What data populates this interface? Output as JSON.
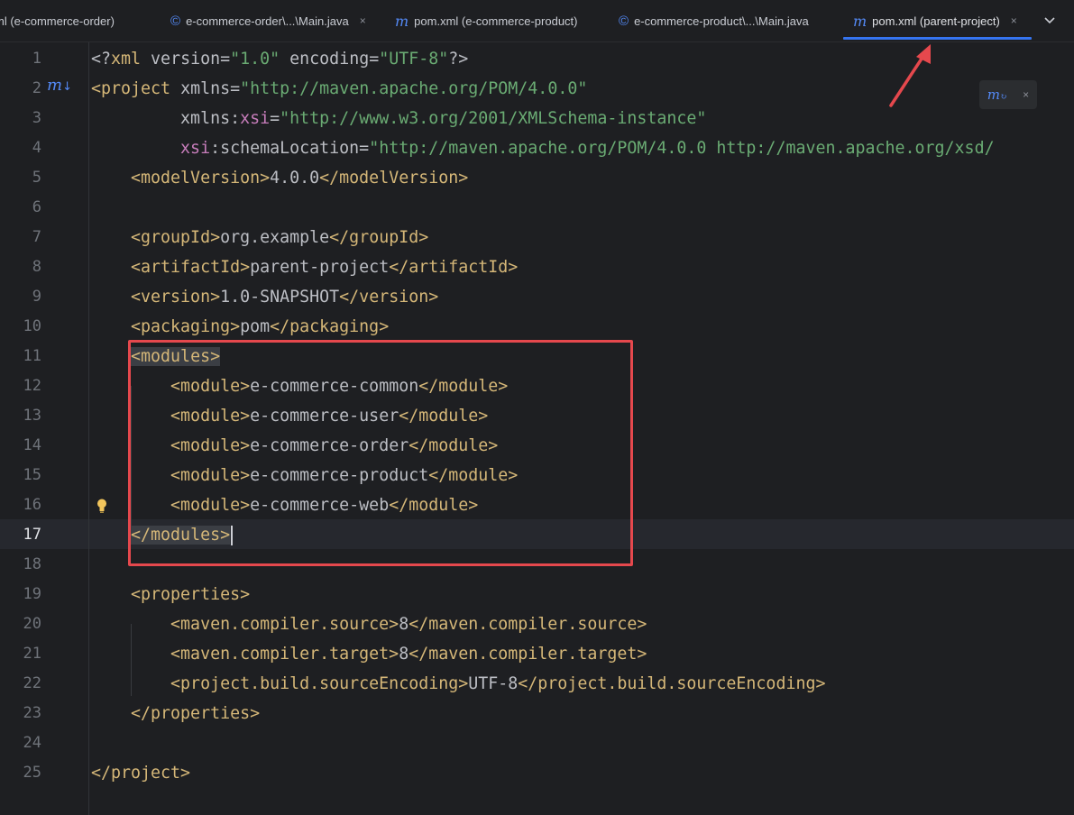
{
  "tabs": [
    {
      "label": "ml (e-commerce-order)",
      "icon": "none",
      "closable": false,
      "active": false
    },
    {
      "label": "e-commerce-order\\...\\Main.java",
      "icon": "java-class-icon",
      "closable": true,
      "active": false
    },
    {
      "label": "pom.xml (e-commerce-product)",
      "icon": "maven-icon",
      "closable": false,
      "active": false
    },
    {
      "label": "e-commerce-product\\...\\Main.java",
      "icon": "java-class-icon",
      "closable": false,
      "active": false
    },
    {
      "label": "pom.xml (parent-project)",
      "icon": "maven-icon",
      "closable": true,
      "active": true
    }
  ],
  "icons": {
    "close": "×",
    "chevron": "⌄",
    "maven": "m",
    "java_class": "©",
    "lightbulb": "lightbulb-icon"
  },
  "editor": {
    "current_line": 17,
    "highlighted_block": "modules",
    "lines": [
      {
        "num": "1",
        "segments": [
          [
            "p",
            "<?"
          ],
          [
            "t",
            "xml"
          ],
          [
            "a",
            " version"
          ],
          [
            "p",
            "="
          ],
          [
            "v",
            "\"1.0\""
          ],
          [
            "a",
            " encoding"
          ],
          [
            "p",
            "="
          ],
          [
            "v",
            "\"UTF-8\""
          ],
          [
            "p",
            "?>"
          ]
        ]
      },
      {
        "num": "2",
        "segments": [
          [
            "t",
            "<project"
          ],
          [
            "a",
            " xmlns"
          ],
          [
            "p",
            "="
          ],
          [
            "v",
            "\"http://maven.apache.org/POM/4.0.0\""
          ]
        ]
      },
      {
        "num": "3",
        "segments": [
          [
            "a",
            "         xmlns:"
          ],
          [
            "ns",
            "xsi"
          ],
          [
            "p",
            "="
          ],
          [
            "v",
            "\"http://www.w3.org/2001/XMLSchema-instance\""
          ]
        ]
      },
      {
        "num": "4",
        "segments": [
          [
            "ns",
            "         xsi"
          ],
          [
            "a",
            ":schemaLocation"
          ],
          [
            "p",
            "="
          ],
          [
            "v",
            "\"http://maven.apache.org/POM/4.0.0 http://maven.apache.org/xsd/"
          ]
        ]
      },
      {
        "num": "5",
        "segments": [
          [
            "t",
            "    <modelVersion>"
          ],
          [
            "p",
            "4.0.0"
          ],
          [
            "t",
            "</modelVersion>"
          ]
        ]
      },
      {
        "num": "6",
        "segments": []
      },
      {
        "num": "7",
        "segments": [
          [
            "t",
            "    <groupId>"
          ],
          [
            "p",
            "org.example"
          ],
          [
            "t",
            "</groupId>"
          ]
        ]
      },
      {
        "num": "8",
        "segments": [
          [
            "t",
            "    <artifactId>"
          ],
          [
            "p",
            "parent-project"
          ],
          [
            "t",
            "</artifactId>"
          ]
        ]
      },
      {
        "num": "9",
        "segments": [
          [
            "t",
            "    <version>"
          ],
          [
            "p",
            "1.0-SNAPSHOT"
          ],
          [
            "t",
            "</version>"
          ]
        ]
      },
      {
        "num": "10",
        "segments": [
          [
            "t",
            "    <packaging>"
          ],
          [
            "p",
            "pom"
          ],
          [
            "t",
            "</packaging>"
          ]
        ]
      },
      {
        "num": "11",
        "segments": [
          [
            "p",
            "    "
          ],
          [
            "hl",
            "<modules>"
          ]
        ]
      },
      {
        "num": "12",
        "segments": [
          [
            "t",
            "        <module>"
          ],
          [
            "p",
            "e-commerce-common"
          ],
          [
            "t",
            "</module>"
          ]
        ]
      },
      {
        "num": "13",
        "segments": [
          [
            "t",
            "        <module>"
          ],
          [
            "p",
            "e-commerce-user"
          ],
          [
            "t",
            "</module>"
          ]
        ]
      },
      {
        "num": "14",
        "segments": [
          [
            "t",
            "        <module>"
          ],
          [
            "p",
            "e-commerce-order"
          ],
          [
            "t",
            "</module>"
          ]
        ]
      },
      {
        "num": "15",
        "segments": [
          [
            "t",
            "        <module>"
          ],
          [
            "p",
            "e-commerce-product"
          ],
          [
            "t",
            "</module>"
          ]
        ]
      },
      {
        "num": "16",
        "segments": [
          [
            "t",
            "        <module>"
          ],
          [
            "p",
            "e-commerce-web"
          ],
          [
            "t",
            "</module>"
          ]
        ]
      },
      {
        "num": "17",
        "segments": [
          [
            "p",
            "    "
          ],
          [
            "hl",
            "</modules>"
          ]
        ]
      },
      {
        "num": "18",
        "segments": []
      },
      {
        "num": "19",
        "segments": [
          [
            "t",
            "    <properties>"
          ]
        ]
      },
      {
        "num": "20",
        "segments": [
          [
            "t",
            "        <maven.compiler.source>"
          ],
          [
            "p",
            "8"
          ],
          [
            "t",
            "</maven.compiler.source>"
          ]
        ]
      },
      {
        "num": "21",
        "segments": [
          [
            "t",
            "        <maven.compiler.target>"
          ],
          [
            "p",
            "8"
          ],
          [
            "t",
            "</maven.compiler.target>"
          ]
        ]
      },
      {
        "num": "22",
        "segments": [
          [
            "t",
            "        <project.build.sourceEncoding>"
          ],
          [
            "p",
            "UTF-8"
          ],
          [
            "t",
            "</project.build.sourceEncoding>"
          ]
        ]
      },
      {
        "num": "23",
        "segments": [
          [
            "t",
            "    </properties>"
          ]
        ]
      },
      {
        "num": "24",
        "segments": []
      },
      {
        "num": "25",
        "segments": [
          [
            "t",
            "</project>"
          ]
        ]
      }
    ]
  },
  "annotations": {
    "box_color": "#e5484d",
    "arrow_color": "#e5484d"
  },
  "colors": {
    "background": "#1e1f22",
    "tag": "#d5b778",
    "string": "#6aab73",
    "namespace": "#c77dbb",
    "text": "#bcbec4",
    "accent": "#3574f0"
  }
}
